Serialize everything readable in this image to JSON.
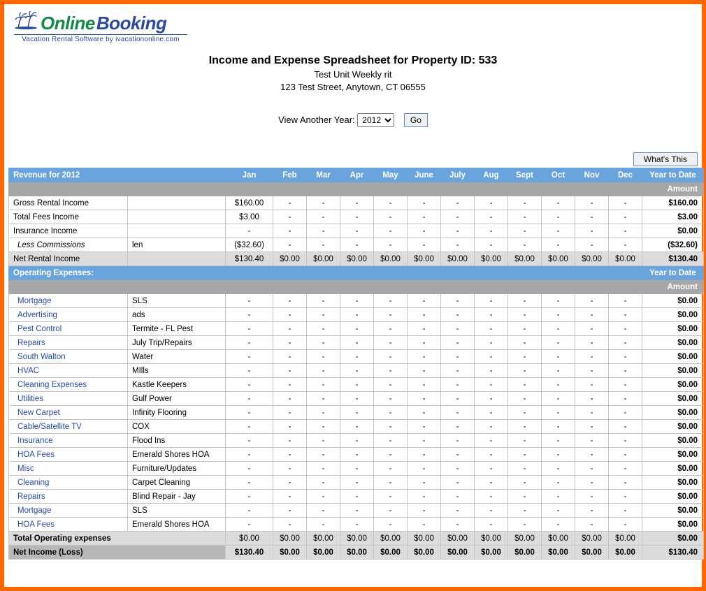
{
  "logo": {
    "online": "Online",
    "booking": "Booking",
    "tag": "Vacation Rental Software by ivacationonline.com"
  },
  "header": {
    "title": "Income and Expense Spreadsheet for Property ID: 533",
    "subtitle": "Test Unit Weekly rit",
    "address": "123 Test Street, Anytown, CT 06555"
  },
  "year_picker": {
    "label": "View Another Year:",
    "selected": "2012",
    "go": "Go"
  },
  "whats_this": "What's This",
  "months": [
    "Jan",
    "Feb",
    "Mar",
    "Apr",
    "May",
    "June",
    "July",
    "Aug",
    "Sept",
    "Oct",
    "Nov",
    "Dec"
  ],
  "revenue": {
    "label": "Revenue for 2012",
    "ytd_label": "Year to Date",
    "amount_label": "Amount",
    "rows": [
      {
        "name": "Gross Rental Income",
        "note": "",
        "link": false,
        "jan": "$160.00",
        "ytd": "$160.00"
      },
      {
        "name": "Total Fees Income",
        "note": "",
        "link": false,
        "jan": "$3.00",
        "ytd": "$3.00"
      },
      {
        "name": "Insurance Income",
        "note": "",
        "link": false,
        "jan": "-",
        "ytd": "$0.00"
      },
      {
        "name": "Less Commissions",
        "note": "len",
        "link": false,
        "italic": true,
        "jan": "($32.60)",
        "ytd": "($32.60)"
      }
    ],
    "net": {
      "name": "Net Rental Income",
      "jan": "$130.40",
      "other": "$0.00",
      "ytd": "$130.40"
    }
  },
  "expenses": {
    "label": "Operating Expenses:",
    "ytd_label": "Year to Date",
    "amount_label": "Amount",
    "rows": [
      {
        "name": "Mortgage",
        "note": "SLS",
        "ytd": "$0.00"
      },
      {
        "name": "Advertising",
        "note": "ads",
        "ytd": "$0.00"
      },
      {
        "name": "Pest Control",
        "note": "Termite - FL Pest",
        "ytd": "$0.00"
      },
      {
        "name": "Repairs",
        "note": "July Trip/Repairs",
        "ytd": "$0.00"
      },
      {
        "name": "South Walton",
        "note": "Water",
        "ytd": "$0.00"
      },
      {
        "name": "HVAC",
        "note": "MIlls",
        "ytd": "$0.00"
      },
      {
        "name": "Cleaning Expenses",
        "note": "Kastle Keepers",
        "ytd": "$0.00"
      },
      {
        "name": "Utilities",
        "note": "Gulf Power",
        "ytd": "$0.00"
      },
      {
        "name": "New Carpet",
        "note": "Infinity Flooring",
        "ytd": "$0.00"
      },
      {
        "name": "Cable/Satellite TV",
        "note": "COX",
        "ytd": "$0.00"
      },
      {
        "name": "Insurance",
        "note": "Flood Ins",
        "ytd": "$0.00"
      },
      {
        "name": "HOA Fees",
        "note": "Emerald Shores HOA",
        "ytd": "$0.00"
      },
      {
        "name": "Misc",
        "note": "Furniture/Updates",
        "ytd": "$0.00"
      },
      {
        "name": "Cleaning",
        "note": "Carpet Cleaning",
        "ytd": "$0.00"
      },
      {
        "name": "Repairs",
        "note": "Blind Repair - Jay",
        "ytd": "$0.00"
      },
      {
        "name": "Mortgage",
        "note": "SLS",
        "ytd": "$0.00"
      },
      {
        "name": "HOA Fees",
        "note": "Emerald Shores HOA",
        "ytd": "$0.00"
      }
    ],
    "total": {
      "name": "Total Operating expenses",
      "val": "$0.00",
      "ytd": "$0.00"
    },
    "net": {
      "name": "Net Income (Loss)",
      "jan": "$130.40",
      "other": "$0.00",
      "ytd": "$130.40"
    }
  }
}
